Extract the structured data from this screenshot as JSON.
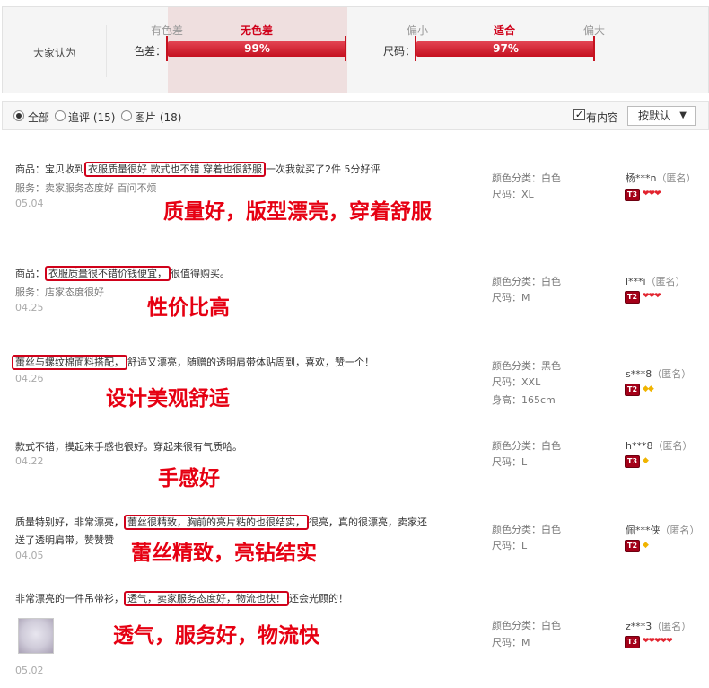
{
  "summary": {
    "title": "大家认为",
    "color_metric": {
      "name": "色差：",
      "tick_left": "有色差",
      "tick_mid": "无色差",
      "value": "99%"
    },
    "size_metric": {
      "name": "尺码：",
      "tick_left": "偏小",
      "tick_mid": "适合",
      "tick_right": "偏大",
      "value": "97%"
    }
  },
  "filter": {
    "all": "全部",
    "followup": "追评 (15)",
    "pictures": "图片 (18)",
    "has_content": "有内容",
    "has_content_checked": true,
    "sort_label": "按默认",
    "sort_caret": "▼"
  },
  "reviews": [
    {
      "line1_pre": "商品：宝贝收到",
      "line1_box": "衣服质量很好 款式也不错 穿着也很舒服",
      "line1_post": "一次我就买了2件 5分好评",
      "line2": "服务：卖家服务态度好 百问不烦",
      "date": "05.04",
      "annotation": "质量好，版型漂亮，穿着舒服",
      "spec1": "颜色分类：白色",
      "spec2": "尺码：XL",
      "user": "杨***n",
      "anon": "（匿名）",
      "level": "T3",
      "gems": "❤❤❤",
      "gem_color": "#e2232e"
    },
    {
      "line1_pre": "商品：",
      "line1_box": "衣服质量很不错价钱便宜，",
      "line1_post": "很值得购买。",
      "line2": "服务：店家态度很好",
      "date": "04.25",
      "annotation": "性价比高",
      "spec1": "颜色分类：白色",
      "spec2": "尺码：M",
      "user": "l***i",
      "anon": "（匿名）",
      "level": "T2",
      "gems": "❤❤❤",
      "gem_color": "#e2232e"
    },
    {
      "line1_pre": "",
      "line1_box": "蕾丝与螺纹棉面料搭配，",
      "line1_post": "舒适又漂亮，随赠的透明肩带体贴周到，喜欢，赞一个！",
      "date": "04.26",
      "annotation": "设计美观舒适",
      "spec1": "颜色分类：黑色",
      "spec2": "尺码：XXL",
      "spec3": "身高：165cm",
      "user": "s***8",
      "anon": "（匿名）",
      "level": "T2",
      "gems": "◆◆",
      "gem_color": "#f0b400"
    },
    {
      "line1": "款式不错，摸起来手感也很好。穿起来很有气质哈。",
      "date": "04.22",
      "annotation": "手感好",
      "spec1": "颜色分类：白色",
      "spec2": "尺码：L",
      "user": "h***8",
      "anon": "（匿名）",
      "level": "T3",
      "gems": "◆",
      "gem_color": "#f0b400"
    },
    {
      "line1_pre": "质量特别好，非常漂亮，",
      "line1_box": "蕾丝很精致，胸前的亮片粘的也很结实，",
      "line1_post": "很亮，真的很漂亮，卖家还",
      "line2": "送了透明肩带，赞赞赞",
      "date": "04.05",
      "annotation": "蕾丝精致，亮钻结实",
      "spec1": "颜色分类：白色",
      "spec2": "尺码：L",
      "user": "佩***侠",
      "anon": "（匿名）",
      "level": "T2",
      "gems": "◆",
      "gem_color": "#f0b400"
    },
    {
      "line1_pre": "非常漂亮的一件吊带衫，",
      "line1_box": "透气，卖家服务态度好，物流也快！",
      "line1_post": "还会光顾的！",
      "date": "05.02",
      "annotation": "透气，服务好，物流快",
      "spec1": "颜色分类：白色",
      "spec2": "尺码：M",
      "user": "z***3",
      "anon": "（匿名）",
      "level": "T3",
      "gems": "❤❤❤❤❤",
      "gem_color": "#e2232e"
    }
  ]
}
